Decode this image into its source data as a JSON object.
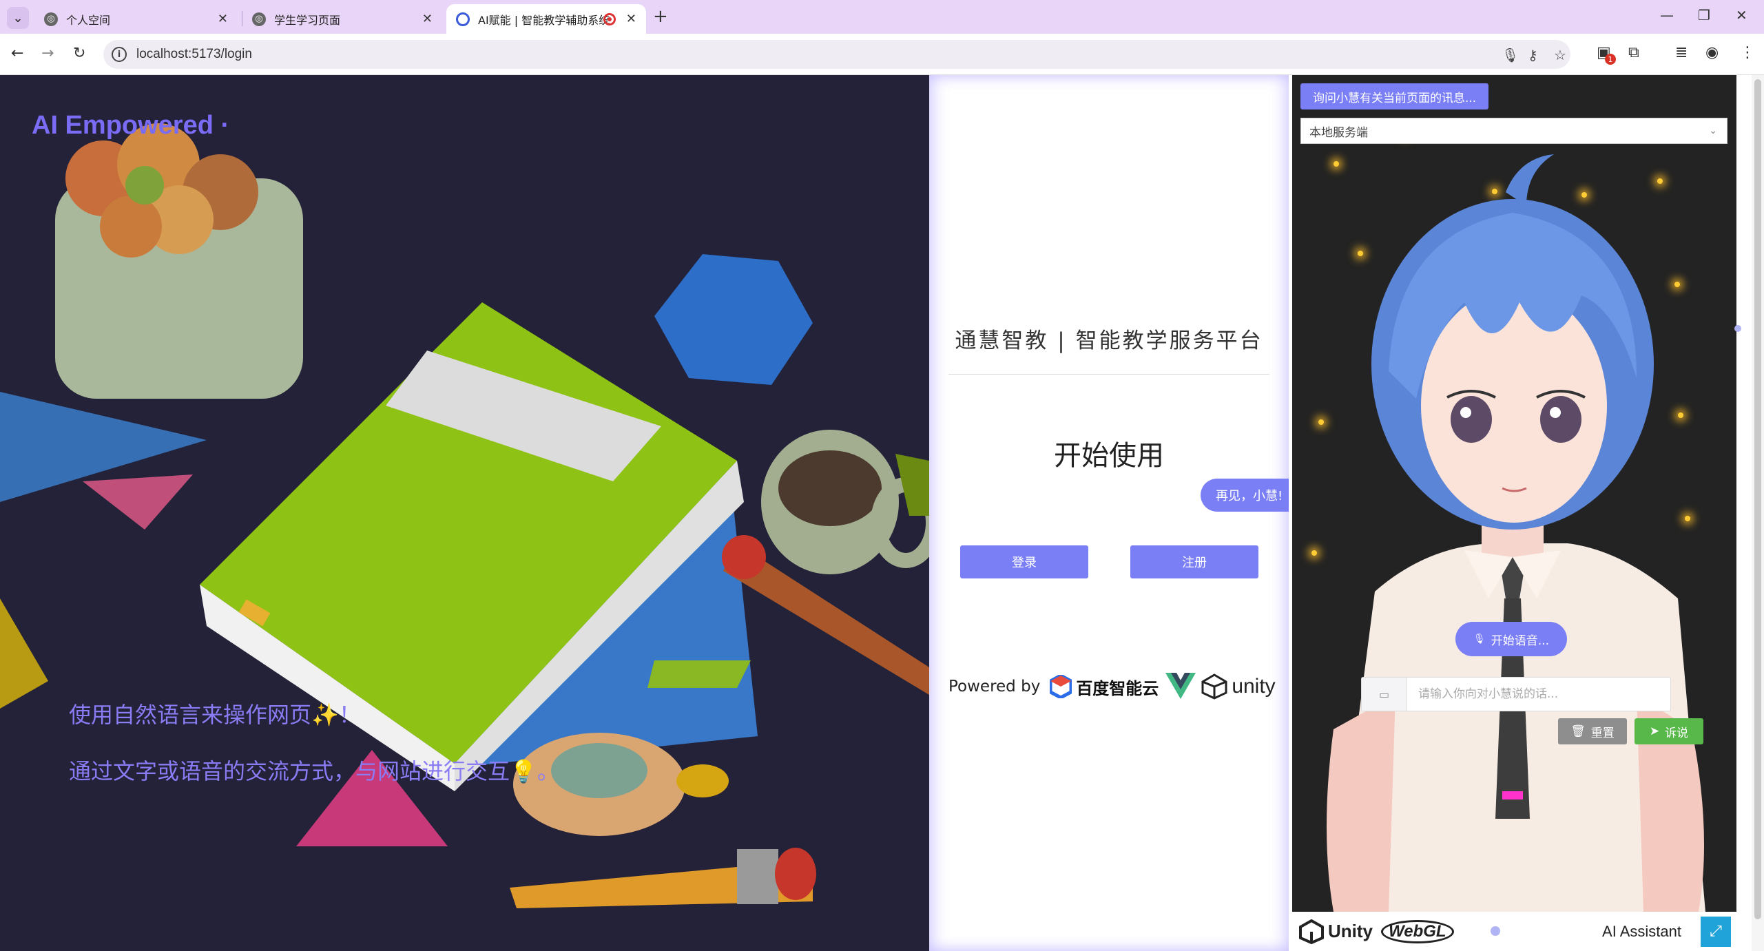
{
  "browser": {
    "tabs": [
      {
        "title": "个人空间"
      },
      {
        "title": "学生学习页面"
      },
      {
        "title": "AI赋能 | 智能教学辅助系统"
      }
    ],
    "url": "localhost:5173/login",
    "extension_badge": "1"
  },
  "hero": {
    "title": "AI Empowered ·",
    "caption_line1": "使用自然语言来操作网页✨！",
    "caption_line2": "通过文字或语音的交流方式，与网站进行交互💡。"
  },
  "login": {
    "platform_title": "通慧智教 | 智能教学服务平台",
    "start_title": "开始使用",
    "login_label": "登录",
    "register_label": "注册",
    "powered_by": "Powered by",
    "baidu_cloud": "百度智能云",
    "unity": "unity"
  },
  "assistant": {
    "bye_bubble": "再见，小慧!",
    "ask_button": "询问小慧有关当前页面的讯息...",
    "server_select": "本地服务端",
    "voice_button": "开始语音...",
    "chat_placeholder": "请输入你向对小慧说的话...",
    "reset_label": "重置",
    "send_label": "诉说",
    "footer_unity": "Unity",
    "footer_webgl": "WebGL",
    "footer_title": "AI Assistant"
  },
  "colors": {
    "accent": "#7b7ff5",
    "send_green": "#58b84a",
    "reset_gray": "#8e8e8e",
    "tabbar": "#e9d5f7",
    "hero_bg": "#232238"
  }
}
